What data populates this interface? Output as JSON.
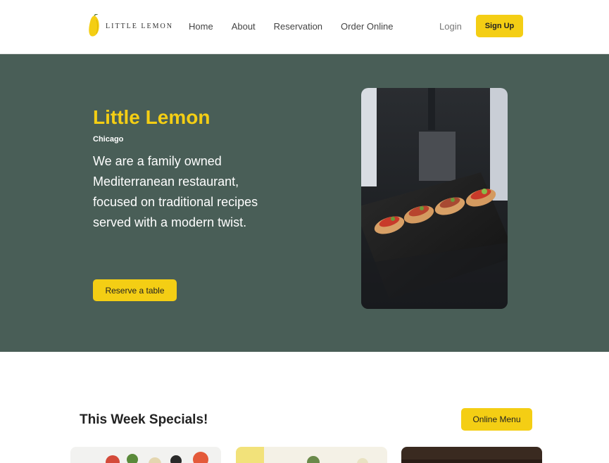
{
  "nav": {
    "logo_text": "LITTLE LEMON",
    "links": [
      "Home",
      "About",
      "Reservation",
      "Order Online"
    ],
    "login": "Login",
    "signup": "Sign Up"
  },
  "hero": {
    "title": "Little Lemon",
    "subtitle": "Chicago",
    "description": "We are a family owned Mediterranean restaurant, focused on traditional recipes served with a modern twist.",
    "cta": "Reserve a table"
  },
  "specials": {
    "title": "This Week Specials!",
    "cta": "Online Menu"
  },
  "colors": {
    "primary_green": "#495e57",
    "primary_yellow": "#f4ce14"
  }
}
